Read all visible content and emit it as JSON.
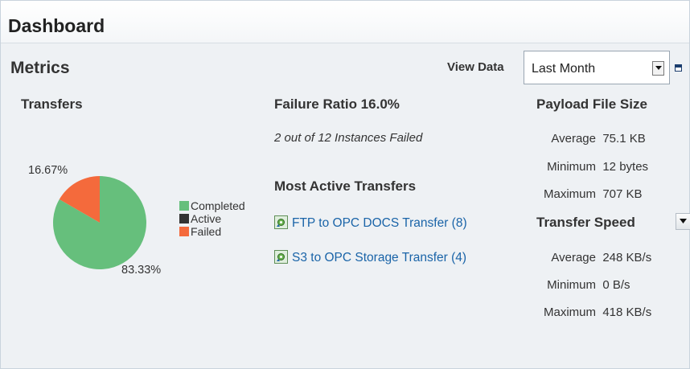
{
  "header": {
    "title": "Dashboard"
  },
  "metrics": {
    "title": "Metrics",
    "view_data_label": "View Data",
    "view_data_selected": "Last Month"
  },
  "transfers": {
    "title": "Transfers",
    "legend": [
      {
        "label": "Completed",
        "color": "#66bf7c"
      },
      {
        "label": "Active",
        "color": "#333333"
      },
      {
        "label": "Failed",
        "color": "#f46a3c"
      }
    ],
    "slice_labels": {
      "failed": "16.67%",
      "completed": "83.33%"
    }
  },
  "chart_data": {
    "type": "pie",
    "categories": [
      "Completed",
      "Active",
      "Failed"
    ],
    "values": [
      83.33,
      0,
      16.67
    ],
    "colors": [
      "#66bf7c",
      "#333333",
      "#f46a3c"
    ],
    "legend": "right"
  },
  "failure": {
    "title": "Failure Ratio 16.0%",
    "detail": "2 out of 12 Instances Failed"
  },
  "most_active": {
    "title": "Most Active Transfers",
    "items": [
      {
        "label": "FTP to OPC DOCS Transfer (8)"
      },
      {
        "label": "S3 to OPC Storage Transfer (4)"
      }
    ]
  },
  "payload": {
    "title": "Payload File Size",
    "stats": [
      {
        "key": "Average",
        "value": "75.1 KB"
      },
      {
        "key": "Minimum",
        "value": "12 bytes"
      },
      {
        "key": "Maximum",
        "value": "707 KB"
      }
    ]
  },
  "speed": {
    "title": "Transfer Speed",
    "stats": [
      {
        "key": "Average",
        "value": "248 KB/s"
      },
      {
        "key": "Minimum",
        "value": "0 B/s"
      },
      {
        "key": "Maximum",
        "value": "418 KB/s"
      }
    ]
  },
  "icons": {
    "transfer_link_icon": "transfer-gear-icon",
    "maximize": "maximize-icon",
    "dropdown": "chevron-down-icon"
  }
}
